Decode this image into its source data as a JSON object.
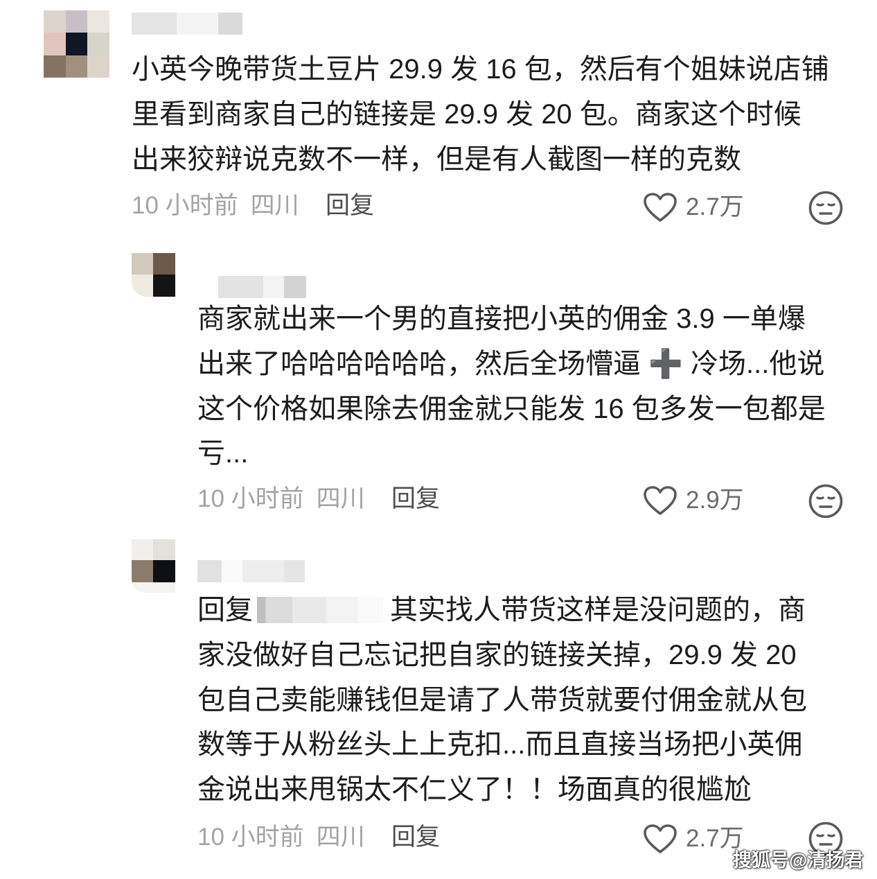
{
  "comments": [
    {
      "lines": [
        "小英今晚带货土豆片 29.9 发 16 包，然后有个姐妹说店铺",
        "里看到商家自己的链接是 29.9 发 20 包。商家这个时候",
        "出来狡辩说克数不一样，但是有人截图一样的克数"
      ],
      "time": "10 小时前",
      "location": "四川",
      "reply_label": "回复",
      "likes": "2.7万"
    },
    {
      "lines": [
        "商家就出来一个男的直接把小英的佣金 3.9 一单爆",
        "出来了哈哈哈哈哈哈，然后全场懵逼 ➕ 冷场...他说",
        "这个价格如果除去佣金就只能发 16 包多发一包都是",
        "亏..."
      ],
      "time": "10 小时前",
      "location": "四川",
      "reply_label": "回复",
      "likes": "2.9万"
    },
    {
      "reply_prefix": "回复",
      "lines": [
        "其实找人带货这样是没问题的，商",
        "家没做好自己忘记把自家的链接关掉，29.9 发 20",
        "包自己卖能赚钱但是请了人带货就要付佣金就从包",
        "数等于从粉丝头上上克扣...而且直接当场把小英佣",
        "金说出来甩锅太不仁义了！！场面真的很尴尬"
      ],
      "time": "10 小时前",
      "location": "四川",
      "reply_label": "回复",
      "likes": "2.7万"
    }
  ],
  "icons": {
    "like": "heart-outline-icon",
    "dislike": "neutral-face-icon"
  },
  "watermark": "搜狐号@清扬君",
  "colors": {
    "text": "#1c1c1c",
    "meta": "#a3a3a3",
    "reply": "#4d4d4d",
    "icon": "#5a5a5a",
    "count": "#6b6b6b",
    "watermark": "#ffffff"
  }
}
